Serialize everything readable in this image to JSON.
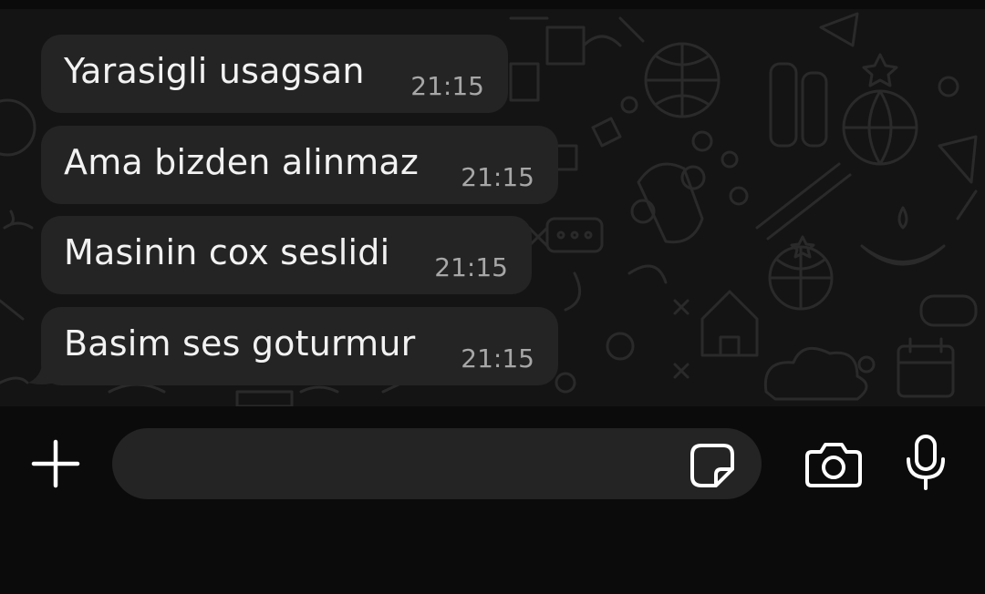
{
  "chat": {
    "messages": [
      {
        "text": "Yarasigli usagsan",
        "time": "21:15"
      },
      {
        "text": "Ama bizden alinmaz",
        "time": "21:15"
      },
      {
        "text": "Masinin cox seslidi",
        "time": "21:15"
      },
      {
        "text": "Basim ses goturmur",
        "time": "21:15"
      }
    ]
  },
  "input_bar": {
    "message_value": "",
    "icons": {
      "add": "plus-icon",
      "sticker": "sticker-icon",
      "camera": "camera-icon",
      "mic": "microphone-icon"
    }
  },
  "colors": {
    "background": "#0b0b0b",
    "wallpaper": "#141414",
    "bubble": "#242424",
    "text": "#f2f2f2",
    "timestamp": "#a7a7a7",
    "icon": "#ffffff"
  }
}
